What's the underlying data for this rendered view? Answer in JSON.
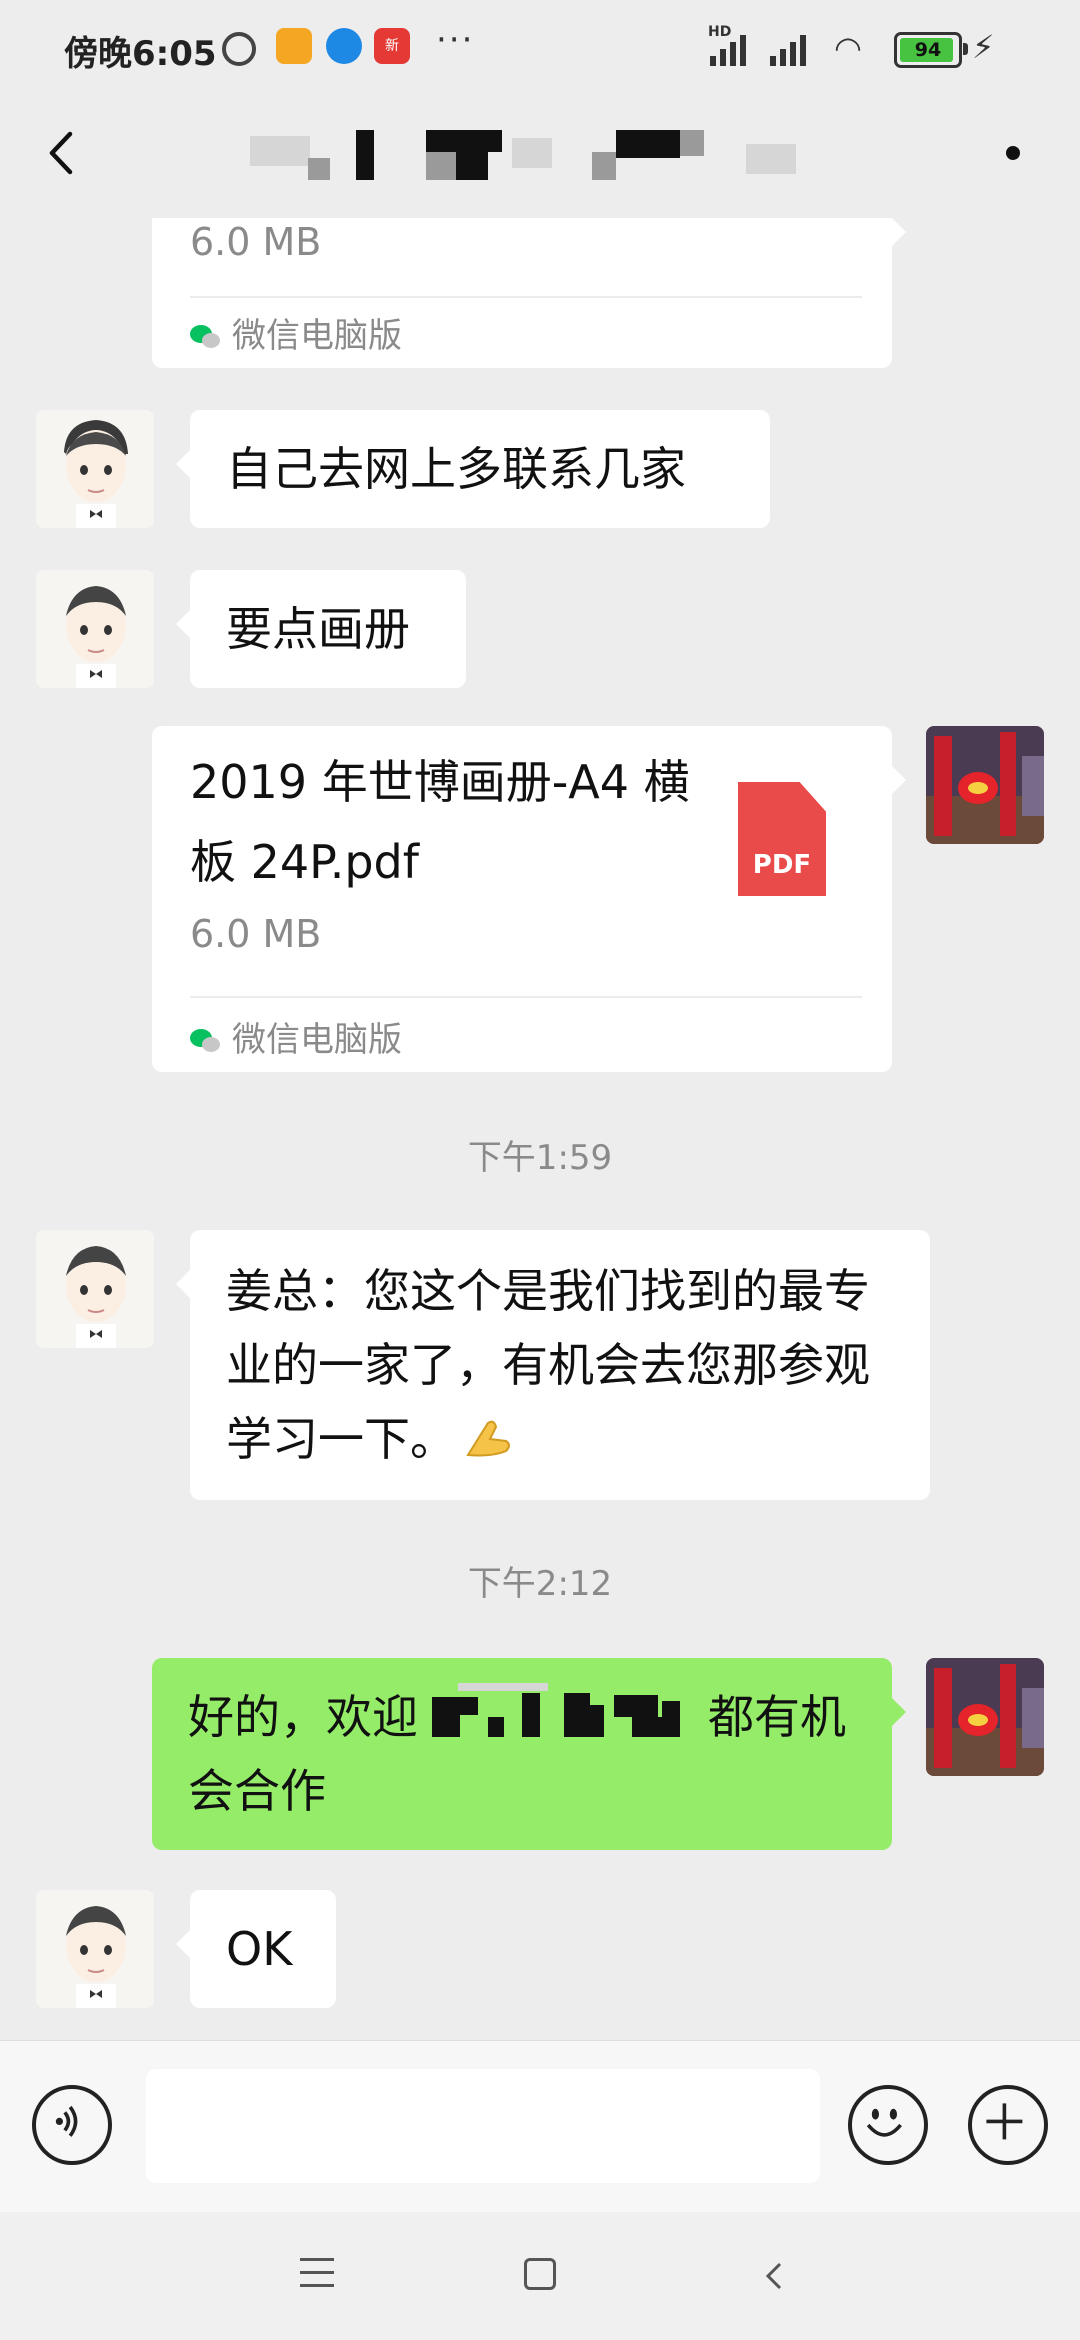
{
  "status_bar": {
    "time": "傍晚6:05",
    "more": "···",
    "app3_label": "新",
    "network_label": "HD",
    "battery_level": "94",
    "battery_fraction": 0.94
  },
  "header": {
    "back_icon": "chevron-left-icon",
    "more_icon": "dot-menu-icon"
  },
  "messages": {
    "file_top": {
      "size": "6.0 MB",
      "source": "微信电脑版"
    },
    "recv_1": "自己去网上多联系几家",
    "recv_2": "要点画册",
    "file_main": {
      "name": "2019 年世博画册-A4 横板 24P.pdf",
      "badge": "PDF",
      "size": "6.0 MB",
      "source": "微信电脑版"
    },
    "time_1": "下午1:59",
    "recv_3": "姜总：您这个是我们找到的最专业的一家了，有机会去您那参观学习一下。",
    "time_2": "下午2:12",
    "sent_1": "好的，欢迎",
    "sent_1_tail": "都有机会合作",
    "recv_4": "OK"
  },
  "input_bar": {
    "voice_icon": "voice-icon",
    "emoji_icon": "emoji-icon",
    "plus_icon": "plus-icon",
    "placeholder": ""
  },
  "nav_bar": {
    "menu_icon": "menu-icon",
    "home_icon": "home-icon",
    "back_icon": "back-triangle-icon"
  },
  "colors": {
    "background": "#ededed",
    "bubble_sent": "#95ec69",
    "bubble_received": "#ffffff",
    "pdf_red": "#e94b4b",
    "wechat_green": "#07c160"
  }
}
